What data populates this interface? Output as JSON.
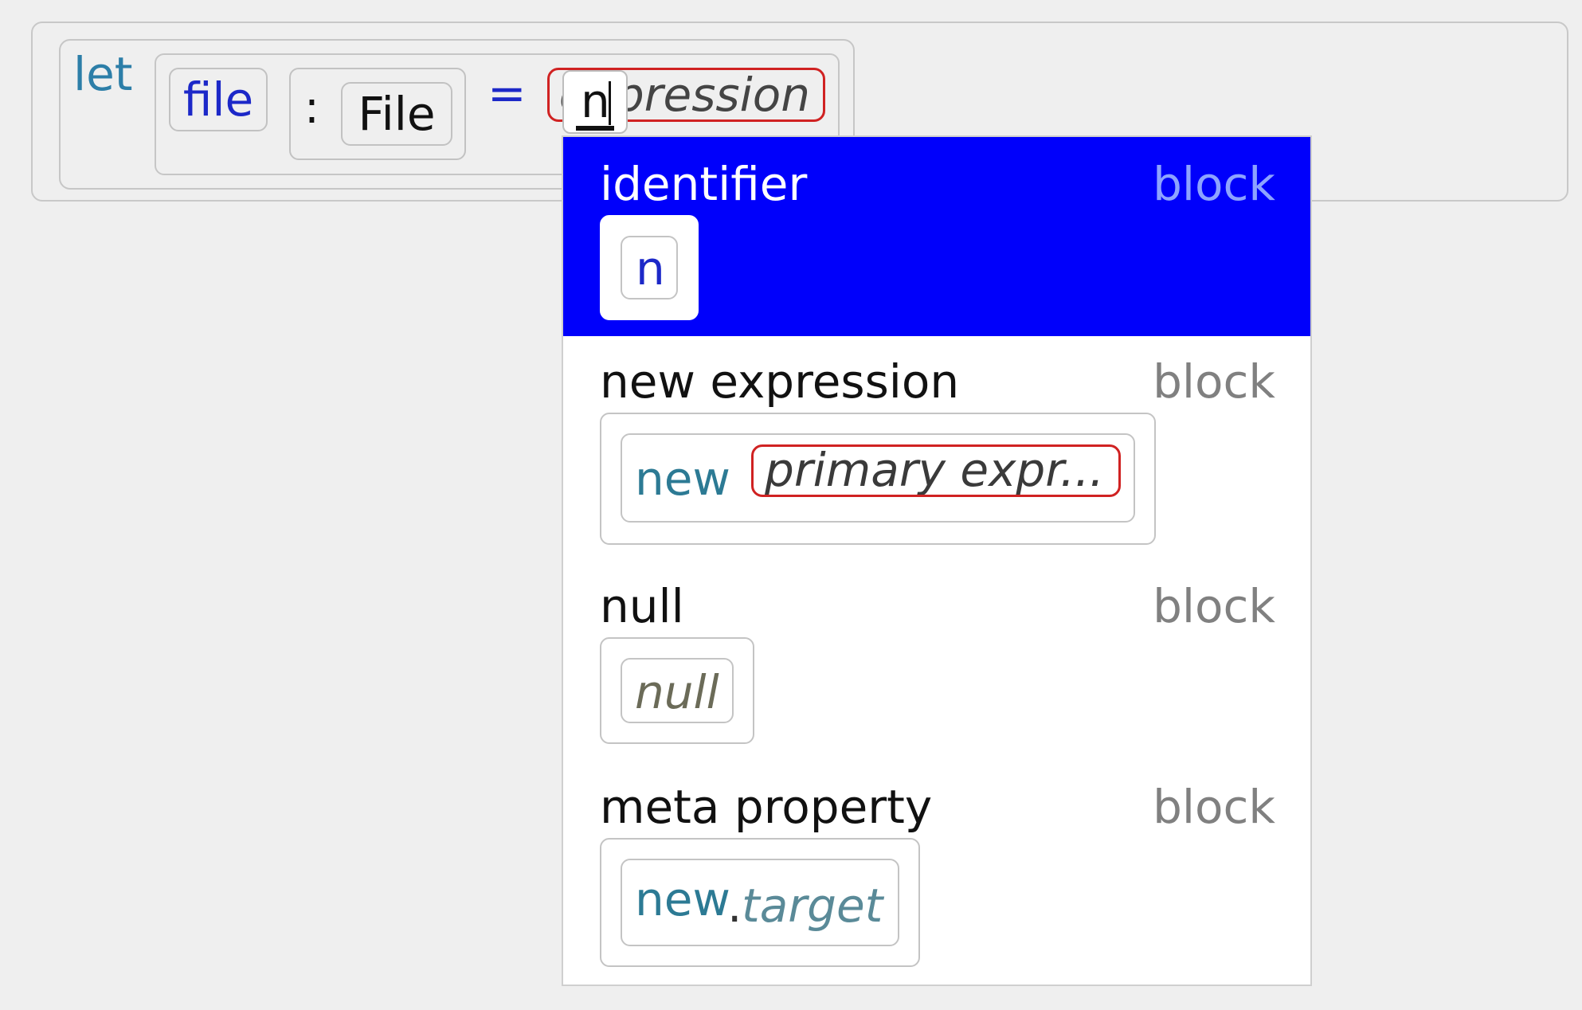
{
  "editor": {
    "keyword_let": "let",
    "identifier": "file",
    "type_colon": ":",
    "type_name": "File",
    "equals": "=",
    "placeholder": "expression",
    "typed_text": "n"
  },
  "completion": {
    "options": [
      {
        "title": "identifier",
        "kind": "block",
        "selected": true,
        "preview": {
          "text": "n"
        }
      },
      {
        "title": "new expression",
        "kind": "block",
        "selected": false,
        "preview": {
          "keyword": "new",
          "hole": "primary expr..."
        }
      },
      {
        "title": "null",
        "kind": "block",
        "selected": false,
        "preview": {
          "text": "null"
        }
      },
      {
        "title": "meta property",
        "kind": "block",
        "selected": false,
        "preview": {
          "keyword": "new",
          "dot": ".",
          "property": "target"
        }
      }
    ]
  },
  "colors": {
    "selection": "#0000fb",
    "hole_border": "#d02222",
    "keyword": "#2c7ea8",
    "identifier": "#1c28c8"
  }
}
